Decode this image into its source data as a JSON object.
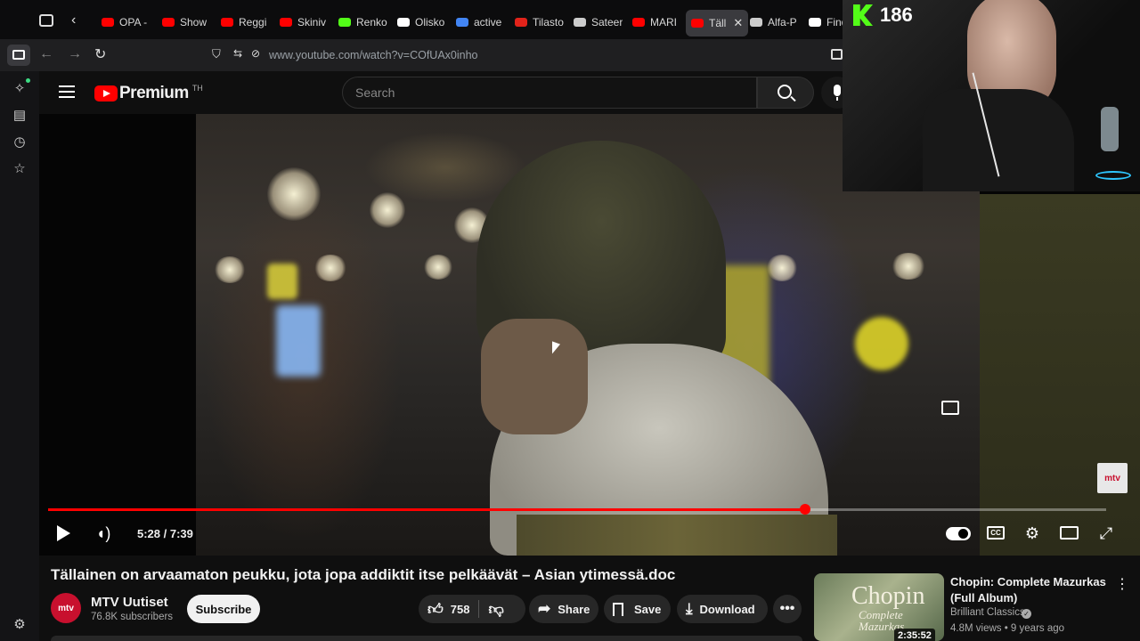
{
  "browser": {
    "tabs": [
      {
        "label": "OPA -",
        "color": "#ff0000"
      },
      {
        "label": "Show",
        "color": "#ff0000"
      },
      {
        "label": "Reggi",
        "color": "#ff0000"
      },
      {
        "label": "Skiniv",
        "color": "#ff0000"
      },
      {
        "label": "Renko",
        "color": "#53fc18"
      },
      {
        "label": "Olisko",
        "color": "#ffffff"
      },
      {
        "label": "active",
        "color": "#4285f4"
      },
      {
        "label": "Tilasto",
        "color": "#e2231a"
      },
      {
        "label": "Sateer",
        "color": "#cccccc"
      },
      {
        "label": "MARI",
        "color": "#ff0000"
      },
      {
        "label": "Täll",
        "color": "#ff0000",
        "active": true
      },
      {
        "label": "Alfa-P",
        "color": "#cccccc"
      },
      {
        "label": "Find",
        "color": "#ffffff"
      }
    ],
    "close_tab_glyph": "✕",
    "url": "www.youtube.com/watch?v=COfUAx0inho"
  },
  "youtube": {
    "logo_text": "Premium",
    "region": "TH",
    "search_placeholder": "Search"
  },
  "player": {
    "time_current": "5:28",
    "time_total": "7:39",
    "time_display": "5:28 / 7:39",
    "progress_fraction": 0.7153,
    "watermark": "mtv"
  },
  "video": {
    "title": "Tällainen on arvaamaton peukku, jota jopa addiktit itse pelkäävät – Asian ytimessä.doc",
    "channel_name": "MTV Uutiset",
    "channel_avatar_text": "mtv",
    "subscribers": "76.8K subscribers",
    "subscribe_label": "Subscribe",
    "likes": "758",
    "share_label": "Share",
    "save_label": "Save",
    "download_label": "Download"
  },
  "recommendation": {
    "title_line1": "Chopin: Complete Mazurkas",
    "title_line2": "(Full Album)",
    "channel": "Brilliant Classics",
    "meta": "4.8M views • 9 years ago",
    "duration": "2:35:52",
    "thumb_title": "Chopin",
    "thumb_subtitle": "Complete Mazurkas"
  },
  "overlay": {
    "kick_viewers": "186",
    "kick_color": "#53fc18"
  },
  "colors": {
    "accent": "#ff0000",
    "background": "#0f0f0f",
    "pill": "#272727"
  }
}
